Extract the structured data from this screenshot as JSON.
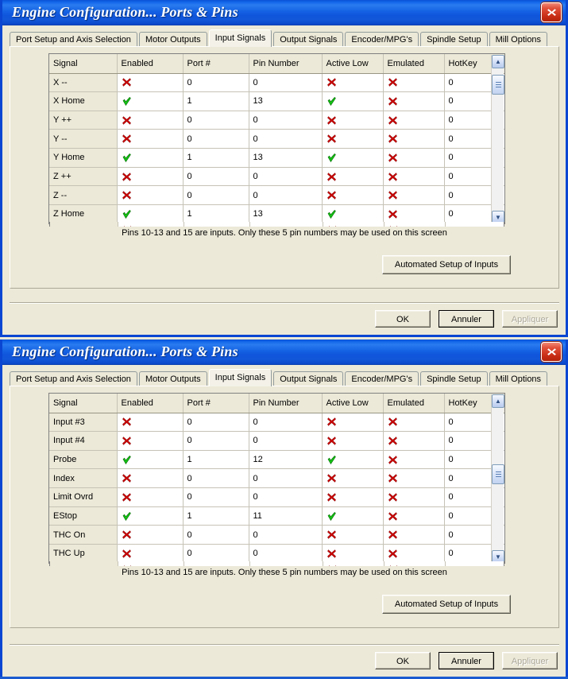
{
  "window": {
    "title": "Engine Configuration... Ports & Pins",
    "close_label": "X",
    "titlebar_color": "#0a4fd6",
    "close_button_color": "#c62b12",
    "face_color": "#ece9d8"
  },
  "tabs": [
    {
      "label": "Port Setup and Axis Selection",
      "active": false
    },
    {
      "label": "Motor Outputs",
      "active": false
    },
    {
      "label": "Input Signals",
      "active": true
    },
    {
      "label": "Output Signals",
      "active": false
    },
    {
      "label": "Encoder/MPG's",
      "active": false
    },
    {
      "label": "Spindle Setup",
      "active": false
    },
    {
      "label": "Mill Options",
      "active": false
    }
  ],
  "grid": {
    "columns": [
      "Signal",
      "Enabled",
      "Port #",
      "Pin Number",
      "Active Low",
      "Emulated",
      "HotKey"
    ],
    "enabled_icon_on": "green-check-icon",
    "enabled_icon_off": "red-x-icon"
  },
  "dialog1": {
    "rows": [
      {
        "signal": "X --",
        "enabled": false,
        "port": "0",
        "pin": "0",
        "active_low": false,
        "emulated": false,
        "hotkey": "0"
      },
      {
        "signal": "X Home",
        "enabled": true,
        "port": "1",
        "pin": "13",
        "active_low": true,
        "emulated": false,
        "hotkey": "0"
      },
      {
        "signal": "Y ++",
        "enabled": false,
        "port": "0",
        "pin": "0",
        "active_low": false,
        "emulated": false,
        "hotkey": "0"
      },
      {
        "signal": "Y --",
        "enabled": false,
        "port": "0",
        "pin": "0",
        "active_low": false,
        "emulated": false,
        "hotkey": "0"
      },
      {
        "signal": "Y Home",
        "enabled": true,
        "port": "1",
        "pin": "13",
        "active_low": true,
        "emulated": false,
        "hotkey": "0"
      },
      {
        "signal": "Z ++",
        "enabled": false,
        "port": "0",
        "pin": "0",
        "active_low": false,
        "emulated": false,
        "hotkey": "0"
      },
      {
        "signal": "Z --",
        "enabled": false,
        "port": "0",
        "pin": "0",
        "active_low": false,
        "emulated": false,
        "hotkey": "0"
      },
      {
        "signal": "Z Home",
        "enabled": true,
        "port": "1",
        "pin": "13",
        "active_low": true,
        "emulated": false,
        "hotkey": "0"
      }
    ],
    "scroll_thumb_top_pct": 8
  },
  "dialog2": {
    "rows": [
      {
        "signal": "Input #3",
        "enabled": false,
        "port": "0",
        "pin": "0",
        "active_low": false,
        "emulated": false,
        "hotkey": "0"
      },
      {
        "signal": "Input #4",
        "enabled": false,
        "port": "0",
        "pin": "0",
        "active_low": false,
        "emulated": false,
        "hotkey": "0"
      },
      {
        "signal": "Probe",
        "enabled": true,
        "port": "1",
        "pin": "12",
        "active_low": true,
        "emulated": false,
        "hotkey": "0"
      },
      {
        "signal": "Index",
        "enabled": false,
        "port": "0",
        "pin": "0",
        "active_low": false,
        "emulated": false,
        "hotkey": "0"
      },
      {
        "signal": "Limit Ovrd",
        "enabled": false,
        "port": "0",
        "pin": "0",
        "active_low": false,
        "emulated": false,
        "hotkey": "0"
      },
      {
        "signal": "EStop",
        "enabled": true,
        "port": "1",
        "pin": "11",
        "active_low": true,
        "emulated": false,
        "hotkey": "0"
      },
      {
        "signal": "THC On",
        "enabled": false,
        "port": "0",
        "pin": "0",
        "active_low": false,
        "emulated": false,
        "hotkey": "0"
      },
      {
        "signal": "THC Up",
        "enabled": false,
        "port": "0",
        "pin": "0",
        "active_low": false,
        "emulated": false,
        "hotkey": "0"
      }
    ],
    "scroll_thumb_top_pct": 45
  },
  "footer": {
    "help_text": "Pins 10-13 and 15 are inputs. Only these 5 pin numbers may be used on this screen",
    "automated_setup_label": "Automated Setup of Inputs",
    "ok_label": "OK",
    "cancel_label": "Annuler",
    "apply_label": "Appliquer",
    "apply_disabled": true
  }
}
